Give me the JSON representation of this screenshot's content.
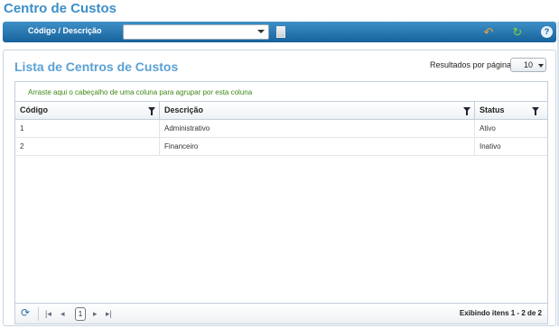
{
  "page": {
    "title": "Centro de Custos"
  },
  "toolbar": {
    "search_label": "Código / Descrição",
    "search_value": "",
    "icons": {
      "dropdown": "chevron-down-icon",
      "document": "document-icon",
      "undo": "undo-icon",
      "refresh": "refresh-icon",
      "help": "help-icon"
    }
  },
  "list": {
    "title": "Lista de Centros de Custos",
    "results_per_page_label": "Resultados por página",
    "results_per_page_value": "10"
  },
  "grid": {
    "group_hint": "Arraste aqui o cabeçalho de uma coluna para agrupar por esta coluna",
    "columns": [
      {
        "label": "Código"
      },
      {
        "label": "Descrição"
      },
      {
        "label": "Status"
      }
    ],
    "rows": [
      {
        "codigo": "1",
        "descricao": "Administrativo",
        "status": "Ativo"
      },
      {
        "codigo": "2",
        "descricao": "Financeiro",
        "status": "Inativo"
      }
    ]
  },
  "pager": {
    "current_page": "1",
    "info": "Exibindo itens 1 - 2 de 2"
  },
  "colors": {
    "title": "#3b8fc9",
    "toolbar": "#17629c",
    "group_hint": "#3d8a16"
  }
}
